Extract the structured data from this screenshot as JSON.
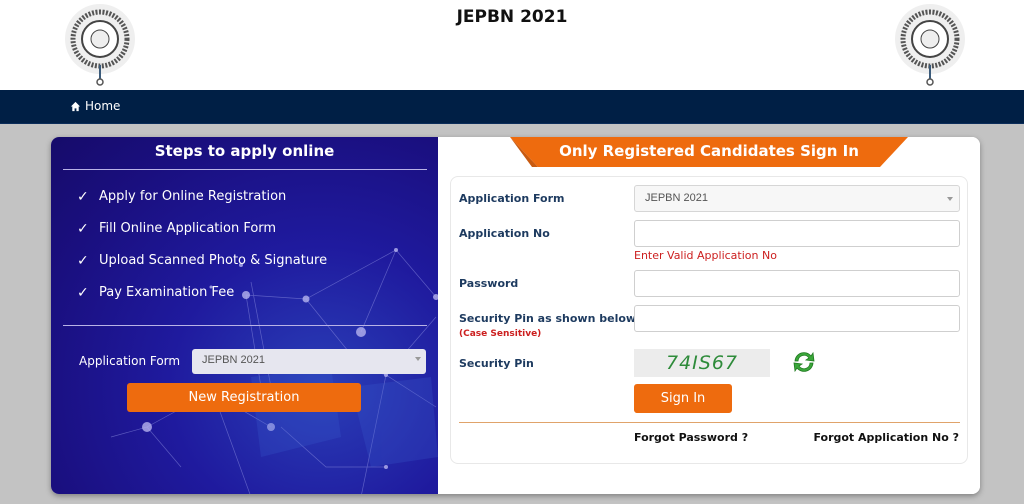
{
  "header": {
    "title": "JEPBN 2021",
    "logo_left_alt": "West Bengal Joint Entrance Examinations Board logo",
    "logo_right_alt": "West Bengal Joint Entrance Examinations Board logo"
  },
  "nav": {
    "home_label": "Home",
    "home_icon": "home-icon"
  },
  "left": {
    "title": "Steps to apply online",
    "steps": [
      "Apply for Online Registration",
      "Fill Online Application Form",
      "Upload Scanned Photo & Signature",
      "Pay Examination Fee"
    ],
    "check_glyph": "✓",
    "form_label": "Application Form",
    "form_select_value": "JEPBN 2021",
    "new_registration_label": "New Registration"
  },
  "right": {
    "title": "Only Registered Candidates Sign In",
    "fields": {
      "application_form_label": "Application Form",
      "application_form_value": "JEPBN 2021",
      "application_no_label": "Application No",
      "application_no_value": "",
      "application_no_error": "Enter Valid Application No",
      "password_label": "Password",
      "password_value": "",
      "security_pin_input_label": "Security Pin as shown below",
      "security_pin_case_note": "(Case Sensitive)",
      "security_pin_input_value": "",
      "security_pin_label": "Security Pin",
      "captcha_text": "74IS67"
    },
    "sign_in_label": "Sign In",
    "forgot_password_label": "Forgot Password ?",
    "forgot_application_label": "Forgot Application No ?"
  },
  "colors": {
    "navbar": "#001f45",
    "accent_orange": "#ee6b0e",
    "error_red": "#cc1f1f",
    "label_blue": "#1d3a5f",
    "captcha_green": "#2e8b3a"
  }
}
